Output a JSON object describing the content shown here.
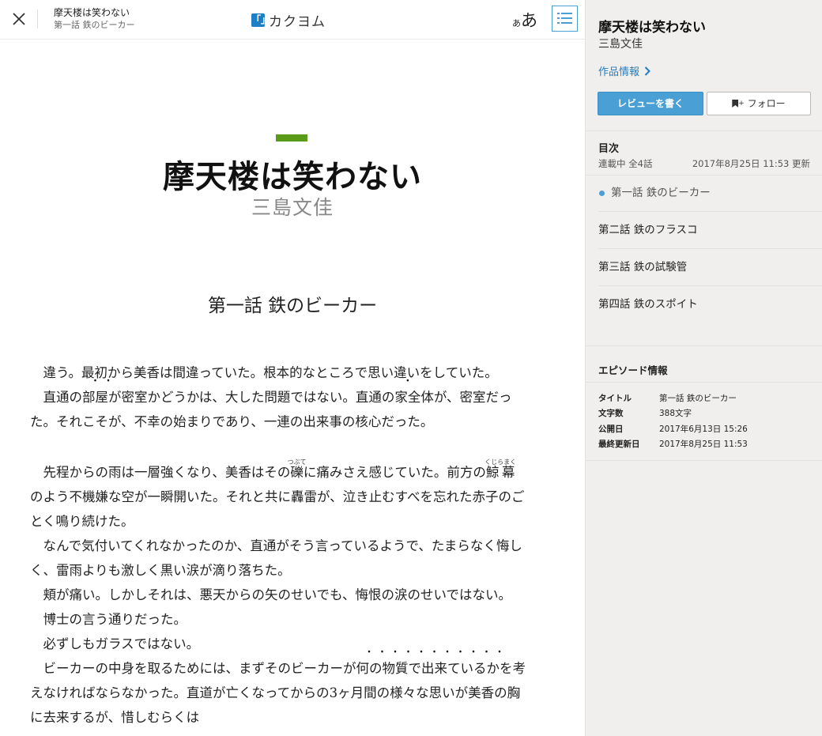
{
  "header": {
    "close_label": "close",
    "work_title": "摩天楼は笑わない",
    "episode_title": "第一話 鉄のビーカー",
    "logo_text": "カクヨム",
    "logo_mark": "「」",
    "font_small": "あ",
    "font_large": "あ"
  },
  "main": {
    "work_title": "摩天楼は笑わない",
    "author": "三島文佳",
    "episode_title": "第一話 鉄のビーカー"
  },
  "body": {
    "p1": "違う。最初から美香は間違っていた。根本的なところで思い違いをしていた。",
    "p2a": "直通の",
    "p2_dot1": "部",
    "p2_dot2": "屋",
    "p2b": "が密室かどうかは、大した問題ではない。直通の",
    "p2_dot3": "家",
    "p2c": "全体が、密室だっ",
    "p2_line2": "た。それこそが、不幸の始まりであり、一連の出来事の核心だった。",
    "p3a": "先程からの雨は一層強くなり、美香はその",
    "ruby1_base": "礫",
    "ruby1_rt": "つぶて",
    "p3b": "に痛みさえ感じていた。前方の",
    "ruby2_base": "鯨幕",
    "ruby2_rt": "くじらまく",
    "p3_line2": "のよう不機嫌な空が一瞬開いた。それと共に轟雷が、泣き止むすべを忘れた赤子のご",
    "p3_line3": "とく鳴り続けた。",
    "p4": "なんで気付いてくれなかったのか、直通がそう言っているようで、たまらなく悔し",
    "p4_line2": "く、雷雨よりも激しく黒い涙が滴り落ちた。",
    "p5": "頬が痛い。しかしそれは、悪天からの矢のせいでも、悔恨の涙のせいではない。",
    "p6": "博士の言う通りだった。",
    "p7": "必ずしもガラスではない。",
    "p8a": "ビーカーの中身を取るためには、まずそのビーカーが",
    "p8_dots": [
      "何",
      "の",
      "物",
      "質",
      "で",
      "出",
      "来",
      "て",
      "い",
      "る",
      "か"
    ],
    "p8b": "を考",
    "p8_line2": "えなければならなかった。直道が亡くなってからの3ヶ月間の様々な思いが美香の胸",
    "p8_line3": "に去来するが、惜しむらくは"
  },
  "sidebar": {
    "work_title": "摩天楼は笑わない",
    "author": "三島文佳",
    "info_link": "作品情報",
    "review_button": "レビューを書く",
    "follow_button": "フォロー",
    "toc_label": "目次",
    "toc_status": "連載中 全4話",
    "toc_updated": "2017年8月25日 11:53 更新",
    "episodes": [
      {
        "title": "第一話 鉄のビーカー",
        "current": true
      },
      {
        "title": "第二話 鉄のフラスコ",
        "current": false
      },
      {
        "title": "第三話 鉄の試験管",
        "current": false
      },
      {
        "title": "第四話 鉄のスポイト",
        "current": false
      }
    ],
    "episode_info_label": "エピソード情報",
    "meta": [
      {
        "key": "タイトル",
        "value": "第一話 鉄のビーカー"
      },
      {
        "key": "文字数",
        "value": "388文字"
      },
      {
        "key": "公開日",
        "value": "2017年6月13日 15:26"
      },
      {
        "key": "最終更新日",
        "value": "2017年8月25日 11:53"
      }
    ]
  },
  "colors": {
    "accent_green": "#5a9b1a",
    "link_blue": "#1e7fc4",
    "button_blue": "#4a9fd5",
    "sidebar_bg": "#f0efee"
  }
}
